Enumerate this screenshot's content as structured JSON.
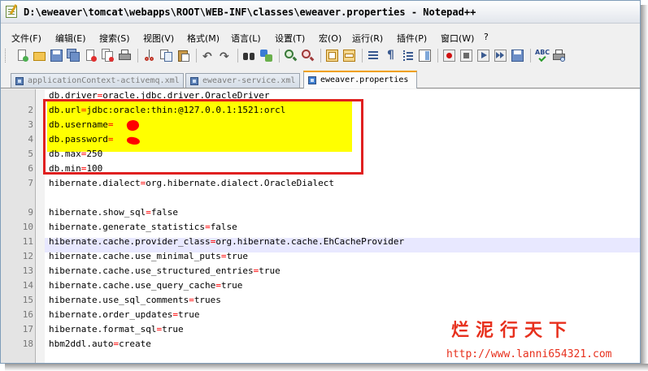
{
  "window": {
    "title": "D:\\eweaver\\tomcat\\webapps\\ROOT\\WEB-INF\\classes\\eweaver.properties - Notepad++"
  },
  "menu": [
    "文件(F)",
    "编辑(E)",
    "搜索(S)",
    "视图(V)",
    "格式(M)",
    "语言(L)",
    "设置(T)",
    "宏(O)",
    "运行(R)",
    "插件(P)",
    "窗口(W)",
    "?"
  ],
  "toolbar_icons": [
    "new-file-icon",
    "open-file-icon",
    "save-icon",
    "save-all-icon",
    "close-icon",
    "close-all-icon",
    "print-icon",
    "cut-icon",
    "copy-icon",
    "paste-icon",
    "undo-icon",
    "redo-icon",
    "find-icon",
    "replace-icon",
    "zoom-in-icon",
    "zoom-out-icon",
    "sync-vertical-icon",
    "sync-horizontal-icon",
    "word-wrap-icon",
    "show-all-chars-icon",
    "indent-guide-icon",
    "document-map-icon",
    "record-macro-icon",
    "stop-macro-icon",
    "play-macro-icon",
    "run-macro-multiple-icon",
    "save-macro-icon",
    "spell-check-icon",
    "print-preview-icon"
  ],
  "tabs": [
    {
      "label": "applicationContext-activemq.xml",
      "active": false
    },
    {
      "label": "eweaver-service.xml",
      "active": false
    },
    {
      "label": "eweaver.properties",
      "active": true
    }
  ],
  "editor": {
    "lines": [
      {
        "num": "",
        "key": "db.driver",
        "value": "oracle.jdbc.driver.OracleDriver"
      },
      {
        "num": "2",
        "key": "db.url",
        "value": "jdbc:oracle:thin:@127.0.0.1:1521:orcl"
      },
      {
        "num": "3",
        "key": "db.username",
        "value": ""
      },
      {
        "num": "4",
        "key": "db.password",
        "value": ""
      },
      {
        "num": "5",
        "key": "db.max",
        "value": "250"
      },
      {
        "num": "6",
        "key": "db.min",
        "value": "100"
      },
      {
        "num": "7",
        "key": "hibernate.dialect",
        "value": "org.hibernate.dialect.OracleDialect"
      },
      {
        "num": "",
        "key": "",
        "value": ""
      },
      {
        "num": "9",
        "key": "hibernate.show_sql",
        "value": "false"
      },
      {
        "num": "10",
        "key": "hibernate.generate_statistics",
        "value": "false"
      },
      {
        "num": "11",
        "key": "hibernate.cache.provider_class",
        "value": "org.hibernate.cache.EhCacheProvider"
      },
      {
        "num": "12",
        "key": "hibernate.cache.use_minimal_puts",
        "value": "true"
      },
      {
        "num": "13",
        "key": "hibernate.cache.use_structured_entries",
        "value": "true"
      },
      {
        "num": "14",
        "key": "hibernate.cache.use_query_cache",
        "value": "true"
      },
      {
        "num": "15",
        "key": "hibernate.use_sql_comments",
        "value": "trues"
      },
      {
        "num": "16",
        "key": "hibernate.order_updates",
        "value": "true"
      },
      {
        "num": "17",
        "key": "hibernate.format_sql",
        "value": "true"
      },
      {
        "num": "18",
        "key": "hbm2ddl.auto",
        "value": "create"
      }
    ],
    "equals": "="
  },
  "watermark": {
    "chinese": "烂泥行天下",
    "url": "http://www.lanni654321.com"
  },
  "colors": {
    "highlight": "#ffff00",
    "frame": "#e02020",
    "operator": "#ff0000",
    "watermark": "#e7301d",
    "tab_active_accent": "#f0a000"
  }
}
